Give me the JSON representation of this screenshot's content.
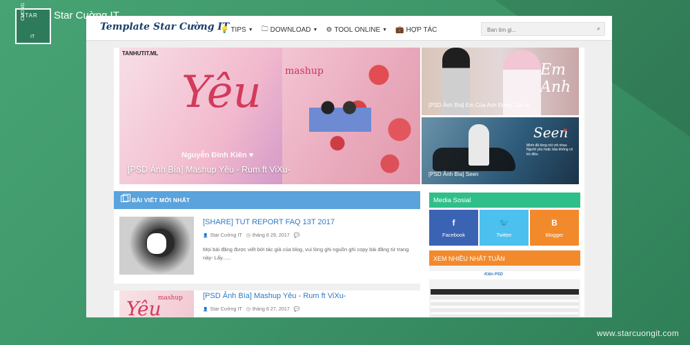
{
  "brand": {
    "logo_lines": [
      "STAR",
      "CUONG",
      "IT"
    ],
    "name": "Star Cuờng IT",
    "watermark": "www.starcuongit.com"
  },
  "site": {
    "title": "Template Star Cường IT",
    "menu": [
      {
        "icon": "lightbulb-icon",
        "label": "TIPS",
        "dropdown": true
      },
      {
        "icon": "folder-icon",
        "label": "DOWNLOAD",
        "dropdown": true
      },
      {
        "icon": "gear-icon",
        "label": "TOOL ONLINE",
        "dropdown": true
      },
      {
        "icon": "briefcase-icon",
        "label": "HỢP TÁC",
        "dropdown": false
      }
    ],
    "search": {
      "placeholder": "Ban tim gi...",
      "icon": "search-icon"
    }
  },
  "featured": {
    "main": {
      "corner_text": "TANHUTIT.ML",
      "script_text": "Yêu",
      "mashup_text": "mashup",
      "subtitle": "Nguyễn Đình Kiên ♥",
      "title": "[PSD Ảnh Bìa] Mashup Yêu - Rum ft ViXu-"
    },
    "side": [
      {
        "script_text": "Em Anh",
        "title": "[PSD Ảnh Bìa] Em Của Anh Đừng Của Ai"
      },
      {
        "script_text": "Seen",
        "lyric": "Mình đã từng nói với nhau Người yêu hoặc bầu không có trò điều",
        "title": "[PSD Ảnh Bìa] Seen"
      }
    ]
  },
  "latest": {
    "header": "BÀI VIẾT MỚI NHẤT",
    "posts": [
      {
        "title": "[SHARE] TUT REPORT FAQ 13T 2017",
        "author": "Star Cường IT",
        "date": "tháng 6 29, 2017",
        "excerpt": "Mọi bài đăng được viết bởi tác giả của blog, vui lòng ghi nguồn ghi copy bài đăng từ trang này- Lấy......"
      },
      {
        "title": "[PSD Ảnh Bìa] Mashup Yêu - Rum ft ViXu-",
        "author": "Star Cường IT",
        "date": "tháng 6 27, 2017",
        "thumb_script": "Yêu",
        "thumb_mashup": "mashup"
      }
    ]
  },
  "sidebar": {
    "media_header": "Media Sosial",
    "social": [
      {
        "icon": "facebook-icon",
        "glyph": "f",
        "label": "Facebook",
        "color": "#3b63b3"
      },
      {
        "icon": "twitter-icon",
        "glyph": "🐦",
        "label": "Twitter",
        "color": "#4cc0ee"
      },
      {
        "icon": "blogger-icon",
        "glyph": "B",
        "label": "Blogger",
        "color": "#f28a2b"
      }
    ],
    "popular_header": "XEM NHIỀU NHẤT TUẦN",
    "popular_logo": "Kiên PSD"
  },
  "colors": {
    "background": "#3f9a6b",
    "accent_blue": "#5aa3dc",
    "link_blue": "#2f79c4",
    "media_green": "#2fbf8a",
    "orange": "#f28a2b"
  }
}
